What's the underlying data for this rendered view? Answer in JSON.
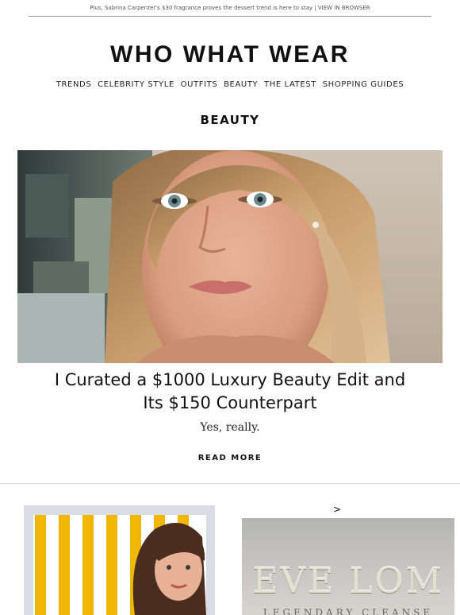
{
  "preheader": {
    "text": "Plus, Sabrina Carpenter's $30 fragrance proves the dessert trend is here to stay",
    "separator": "|",
    "link": "VIEW IN BROWSER"
  },
  "logo": "WHO WHAT WEAR",
  "nav": [
    "TRENDS",
    "CELEBRITY STYLE",
    "OUTFITS",
    "BEAUTY",
    "THE LATEST",
    "SHOPPING GUIDES"
  ],
  "section_title": "BEAUTY",
  "feature": {
    "headline": "I Curated a $1000 Luxury Beauty Edit and Its $150 Counterpart",
    "subhead": "Yes, really.",
    "cta": "READ MORE"
  },
  "secondary": {
    "arrow": ">",
    "right_image_brand": "EVE LOM",
    "right_image_tagline": "LEGENDARY CLEANSE"
  },
  "colors": {
    "text": "#111111",
    "divider": "#dcdcdc",
    "stripe_yellow": "#f2b705"
  }
}
